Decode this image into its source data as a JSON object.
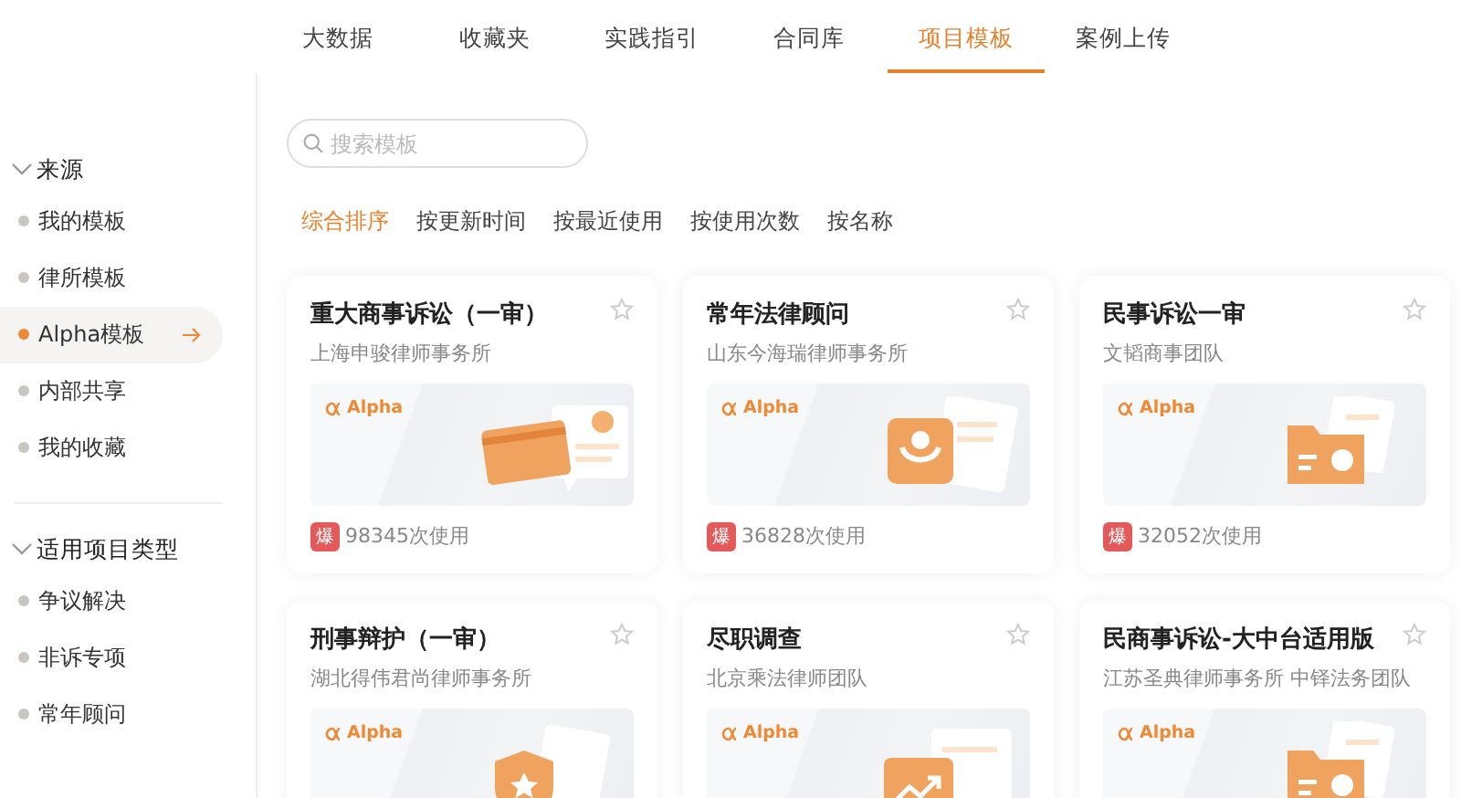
{
  "top_tabs": [
    {
      "label": "大数据",
      "selected": false
    },
    {
      "label": "收藏夹",
      "selected": false
    },
    {
      "label": "实践指引",
      "selected": false
    },
    {
      "label": "合同库",
      "selected": false
    },
    {
      "label": "项目模板",
      "selected": true
    },
    {
      "label": "案例上传",
      "selected": false
    }
  ],
  "sidebar": {
    "groups": [
      {
        "title": "来源",
        "expanded": true,
        "items": [
          {
            "label": "我的模板",
            "selected": false
          },
          {
            "label": "律所模板",
            "selected": false
          },
          {
            "label": "Alpha模板",
            "selected": true
          },
          {
            "label": "内部共享",
            "selected": false
          },
          {
            "label": "我的收藏",
            "selected": false
          }
        ]
      },
      {
        "title": "适用项目类型",
        "expanded": true,
        "items": [
          {
            "label": "争议解决",
            "selected": false
          },
          {
            "label": "非诉专项",
            "selected": false
          },
          {
            "label": "常年顾问",
            "selected": false
          }
        ]
      }
    ]
  },
  "search": {
    "placeholder": "搜索模板"
  },
  "sort_options": [
    {
      "label": "综合排序",
      "selected": true
    },
    {
      "label": "按更新时间",
      "selected": false
    },
    {
      "label": "按最近使用",
      "selected": false
    },
    {
      "label": "按使用次数",
      "selected": false
    },
    {
      "label": "按名称",
      "selected": false
    }
  ],
  "cards": [
    {
      "title": "重大商事诉讼（一审）",
      "org": "上海申骏律师事务所",
      "favorite": false,
      "brand": "Alpha",
      "kind": "card",
      "badge": "爆",
      "usage": "98345次使用"
    },
    {
      "title": "常年法律顾问",
      "org": "山东今海瑞律师事务所",
      "favorite": false,
      "brand": "Alpha",
      "kind": "medal",
      "badge": "爆",
      "usage": "36828次使用"
    },
    {
      "title": "民事诉讼一审",
      "org": "文韬商事团队",
      "favorite": false,
      "brand": "Alpha",
      "kind": "folder",
      "badge": "爆",
      "usage": "32052次使用"
    },
    {
      "title": "刑事辩护（一审）",
      "org": "湖北得伟君尚律师事务所",
      "favorite": false,
      "brand": "Alpha",
      "kind": "shield"
    },
    {
      "title": "尽职调查",
      "org": "北京乘法律师团队",
      "favorite": false,
      "brand": "Alpha",
      "kind": "chart"
    },
    {
      "title": "民商事诉讼-大中台适用版",
      "org": "江苏圣典律师事务所 中铎法务团队",
      "favorite": false,
      "brand": "Alpha",
      "kind": "folder"
    }
  ]
}
